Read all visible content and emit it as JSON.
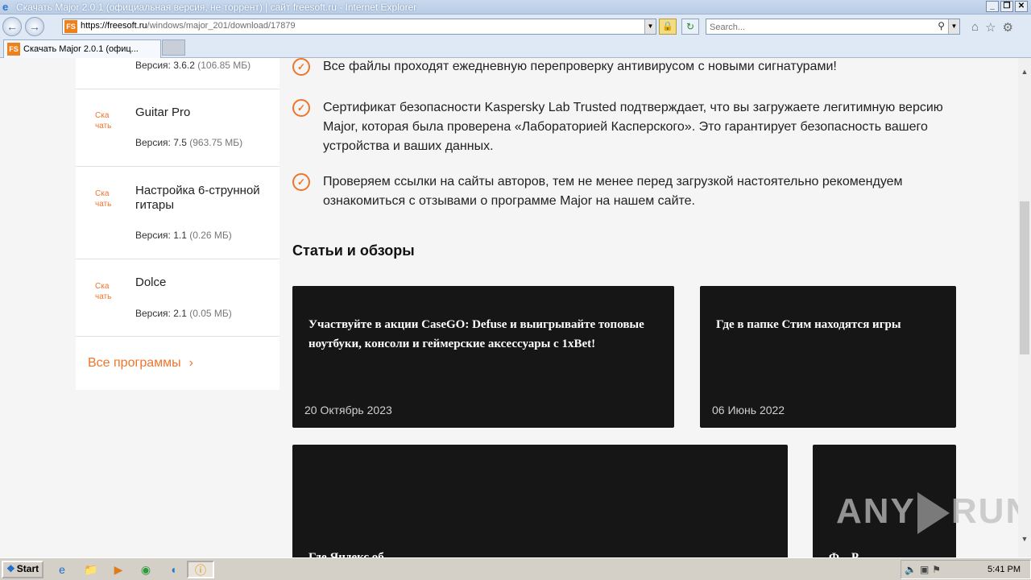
{
  "browser": {
    "title": "Скачать Major 2.0.1 (официальная версия, не торрент) | сайт freesoft.ru - Internet Explorer",
    "url_scheme_host": "https://freesoft.ru",
    "url_path": "/windows/major_201/download/17879",
    "search_placeholder": "Search...",
    "tab_label": "Скачать Major 2.0.1 (офиц...",
    "window_controls": [
      "_",
      "❐",
      "✕"
    ],
    "site_icon_text": "FS"
  },
  "sidebar": {
    "items": [
      {
        "download": "Ска чать",
        "name": "",
        "version_label": "Версия: 3.6.2",
        "size": "(106.85 МБ)"
      },
      {
        "download": "Ска чать",
        "name": "Guitar Pro",
        "version_label": "Версия: 7.5",
        "size": "(963.75 МБ)"
      },
      {
        "download": "Ска чать",
        "name": "Настройка 6-струнной гитары",
        "version_label": "Версия: 1.1",
        "size": "(0.26 МБ)"
      },
      {
        "download": "Ска чать",
        "name": "Dolce",
        "version_label": "Версия: 2.1",
        "size": "(0.05 МБ)"
      }
    ],
    "all_programs": "Все программы"
  },
  "checks": [
    "Все файлы проходят ежедневную перепроверку антивирусом с новыми сигнатурами!",
    "Сертификат безопасности Kaspersky Lab Trusted подтверждает, что вы загружаете легитимную версию Major, которая была проверена «Лабораторией Касперского». Это гарантирует безопасность вашего устройства и ваших данных.",
    "Проверяем ссылки на сайты авторов, тем не менее перед загрузкой настоятельно рекомендуем ознакомиться с отзывами о программе Major на нашем сайте."
  ],
  "articles": {
    "title": "Статьи и обзоры",
    "cards": [
      {
        "title": "Участвуйте в акции CaseGO: Defuse и выигрывайте топовые ноутбуки, консоли и геймерские аксессуары с 1xBet!",
        "date": "20 Октябрь 2023"
      },
      {
        "title": "Где в папке Стим находятся игры",
        "date": "06 Июнь 2022"
      },
      {
        "title": "Где Яндекс об...",
        "date": ""
      },
      {
        "title": "Ф... Р...",
        "date": ""
      }
    ]
  },
  "watermark": {
    "left": "ANY",
    "right": "RUN"
  },
  "taskbar": {
    "start": "Start",
    "clock": "5:41 PM"
  }
}
